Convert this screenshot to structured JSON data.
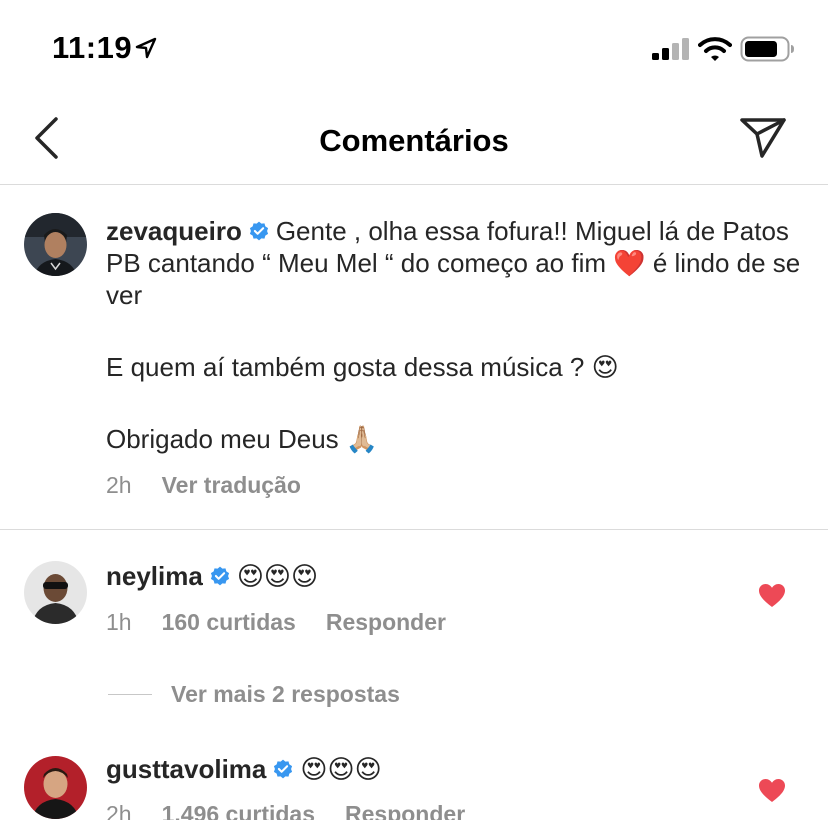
{
  "status_bar": {
    "time": "11:19"
  },
  "header": {
    "title": "Comentários"
  },
  "caption": {
    "username": "zevaqueiro",
    "line1": "Gente , olha essa fofura!! Miguel lá de Patos PB cantando “ Meu Mel “ do começo ao fim ❤️ é lindo de se ver",
    "line2": "E quem aí também gosta dessa música ? 😍",
    "line3": "Obrigado meu Deus 🙏🏼",
    "time": "2h",
    "translate_label": "Ver tradução"
  },
  "comments": [
    {
      "username": "neylima",
      "text": "😍😍😍",
      "time": "1h",
      "likes": "160 curtidas",
      "reply_label": "Responder"
    },
    {
      "username": "gusttavolima",
      "text": "😍😍😍",
      "time": "2h",
      "likes": "1.496 curtidas",
      "reply_label": "Responder"
    }
  ],
  "more_replies_label": "Ver mais 2 respostas",
  "colors": {
    "text": "#262626",
    "secondary": "#8e8e8e",
    "verified": "#3897f0",
    "heart": "#ed4956"
  }
}
